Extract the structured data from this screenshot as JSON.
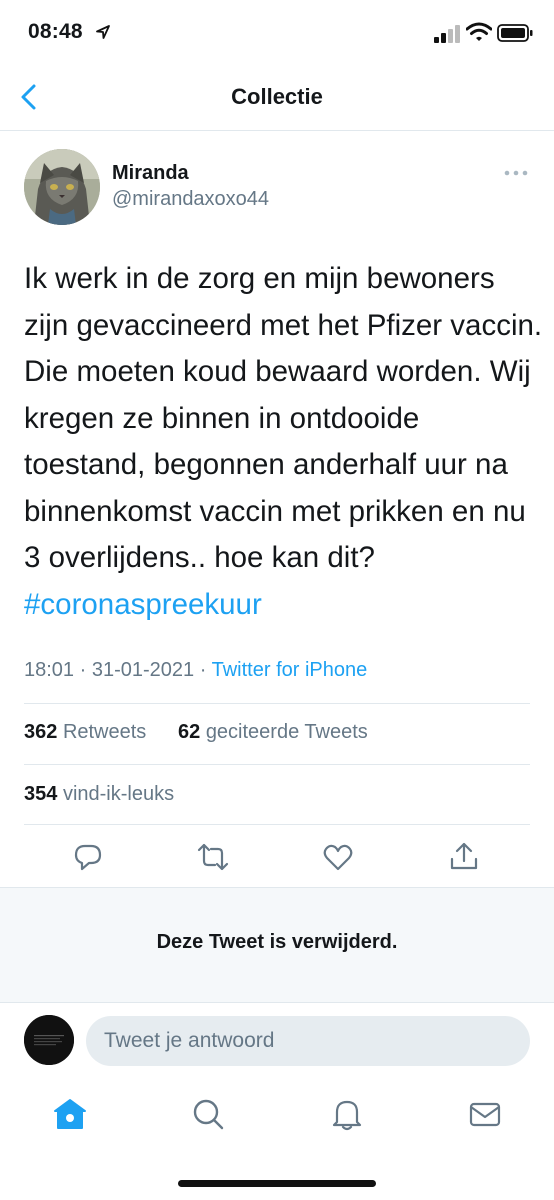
{
  "status_bar": {
    "time": "08:48"
  },
  "nav": {
    "title": "Collectie",
    "back_icon": "chevron-left-icon"
  },
  "tweet": {
    "name": "Miranda",
    "handle": "@mirandaxoxo44",
    "text": "Ik werk in de zorg en mijn bewoners zijn gevaccineerd met het Pfizer vaccin. Die moeten koud bewaard worden. Wij kregen ze binnen in ontdooide toestand, begonnen anderhalf uur na binnenkomst vaccin met prikken en nu 3 overlijdens.. hoe kan dit?",
    "hashtag": "#coronaspreekuur",
    "time": "18:01",
    "date": "31-01-2021",
    "separator": "·",
    "source": "Twitter for iPhone",
    "retweets_count": "362",
    "retweets_label": "Retweets",
    "quotes_count": "62",
    "quotes_label": "geciteerde Tweets",
    "likes_count": "354",
    "likes_label": "vind-ik-leuks"
  },
  "deleted_notice": "Deze Tweet is verwijderd.",
  "reply": {
    "placeholder": "Tweet je antwoord"
  },
  "colors": {
    "accent": "#1da1f2",
    "secondary_text": "#657786"
  }
}
